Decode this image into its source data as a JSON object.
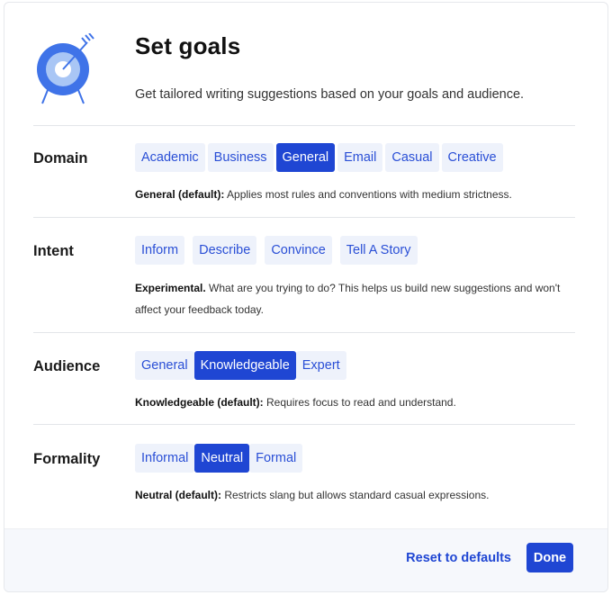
{
  "dialog": {
    "title": "Set goals",
    "subtitle": "Get tailored writing suggestions based on your goals and audience.",
    "icon": "target-goal-icon"
  },
  "sections": {
    "domain": {
      "label": "Domain",
      "options": [
        "Academic",
        "Business",
        "General",
        "Email",
        "Casual",
        "Creative"
      ],
      "selected": "General",
      "desc_bold": "General (default):",
      "desc_text": " Applies most rules and conventions with medium strictness."
    },
    "intent": {
      "label": "Intent",
      "options": [
        "Inform",
        "Describe",
        "Convince",
        "Tell A Story"
      ],
      "desc_bold": "Experimental.",
      "desc_text": " What are you trying to do? This helps us build new suggestions and won't affect your feedback today."
    },
    "audience": {
      "label": "Audience",
      "options": [
        "General",
        "Knowledgeable",
        "Expert"
      ],
      "selected": "Knowledgeable",
      "desc_bold": "Knowledgeable (default):",
      "desc_text": " Requires focus to read and understand."
    },
    "formality": {
      "label": "Formality",
      "options": [
        "Informal",
        "Neutral",
        "Formal"
      ],
      "selected": "Neutral",
      "desc_bold": "Neutral (default):",
      "desc_text": " Restricts slang but allows standard casual expressions."
    }
  },
  "footer": {
    "reset_label": "Reset to defaults",
    "done_label": "Done"
  },
  "colors": {
    "accent": "#1f46d3",
    "option_bg": "#eef2fb",
    "icon_blue": "#3f73e8",
    "icon_light": "#a9c6f5"
  }
}
